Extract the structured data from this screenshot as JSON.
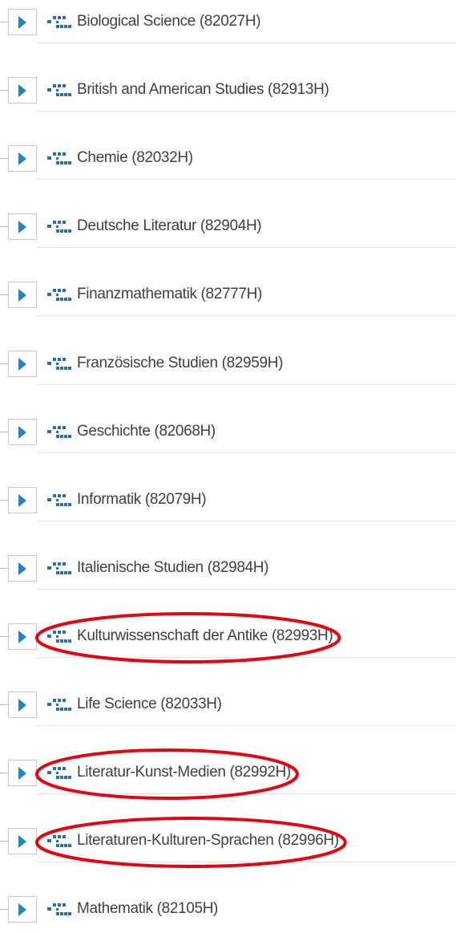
{
  "tree": {
    "items": [
      {
        "label": "Biological Science (82027H)",
        "highlighted": false
      },
      {
        "label": "British and American Studies (82913H)",
        "highlighted": false
      },
      {
        "label": "Chemie (82032H)",
        "highlighted": false
      },
      {
        "label": "Deutsche Literatur (82904H)",
        "highlighted": false
      },
      {
        "label": "Finanzmathematik (82777H)",
        "highlighted": false
      },
      {
        "label": "Französische Studien (82959H)",
        "highlighted": false
      },
      {
        "label": "Geschichte (82068H)",
        "highlighted": false
      },
      {
        "label": "Informatik (82079H)",
        "highlighted": false
      },
      {
        "label": "Italienische Studien (82984H)",
        "highlighted": false
      },
      {
        "label": "Kulturwissenschaft der Antike (82993H)",
        "highlighted": true
      },
      {
        "label": "Life Science (82033H)",
        "highlighted": false
      },
      {
        "label": "Literatur-Kunst-Medien (82992H)",
        "highlighted": true
      },
      {
        "label": "Literaturen-Kulturen-Sprachen (82996H)",
        "highlighted": true
      },
      {
        "label": "Mathematik (82105H)",
        "highlighted": false
      }
    ]
  },
  "icons": {
    "expand": "chevron-right-icon",
    "node": "org-unit-icon"
  },
  "colors": {
    "chevron": "#1f86c4",
    "node_icon": "#2c6ea6",
    "label": "#3f3f3f",
    "annotation": "#e30613"
  }
}
